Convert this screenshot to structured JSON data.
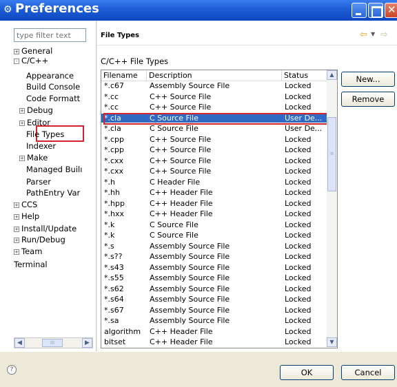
{
  "window": {
    "title": "Preferences",
    "icon": "gear-icon"
  },
  "left": {
    "filter_placeholder": "type filter text",
    "tree": [
      {
        "label": "General",
        "expanded": false
      },
      {
        "label": "C/C++",
        "expanded": true
      },
      {
        "label": "Appearance"
      },
      {
        "label": "Build Console"
      },
      {
        "label": "Code Formatt"
      },
      {
        "label": "Debug",
        "expanded": false
      },
      {
        "label": "Editor",
        "expanded": false
      },
      {
        "label": "File Types",
        "selected": true
      },
      {
        "label": "Indexer"
      },
      {
        "label": "Make",
        "expanded": false
      },
      {
        "label": "Managed Builı"
      },
      {
        "label": "Parser"
      },
      {
        "label": "PathEntry Var"
      },
      {
        "label": "CCS",
        "expanded": false
      },
      {
        "label": "Help",
        "expanded": false
      },
      {
        "label": "Install/Update",
        "expanded": false
      },
      {
        "label": "Run/Debug",
        "expanded": false
      },
      {
        "label": "Team",
        "expanded": false
      },
      {
        "label": "Terminal"
      }
    ],
    "scroll_thumb": "III"
  },
  "right": {
    "page_title": "File Types",
    "section_label": "C/C++ File Types",
    "columns": [
      "Filename",
      "Description",
      "Status"
    ],
    "rows": [
      [
        "*.c67",
        "Assembly Source File",
        "Locked"
      ],
      [
        "*.cc",
        "C++ Source File",
        "Locked"
      ],
      [
        "*.cc",
        "C++ Source File",
        "Locked"
      ],
      [
        "*.cla",
        "C Source File",
        "User De..."
      ],
      [
        "*.cla",
        "C Source File",
        "User De..."
      ],
      [
        "*.cpp",
        "C++ Source File",
        "Locked"
      ],
      [
        "*.cpp",
        "C++ Source File",
        "Locked"
      ],
      [
        "*.cxx",
        "C++ Source File",
        "Locked"
      ],
      [
        "*.cxx",
        "C++ Source File",
        "Locked"
      ],
      [
        "*.h",
        "C Header File",
        "Locked"
      ],
      [
        "*.hh",
        "C++ Header File",
        "Locked"
      ],
      [
        "*.hpp",
        "C++ Header File",
        "Locked"
      ],
      [
        "*.hxx",
        "C++ Header File",
        "Locked"
      ],
      [
        "*.k",
        "C Source File",
        "Locked"
      ],
      [
        "*.k",
        "C Source File",
        "Locked"
      ],
      [
        "*.s",
        "Assembly Source File",
        "Locked"
      ],
      [
        "*.s??",
        "Assembly Source File",
        "Locked"
      ],
      [
        "*.s43",
        "Assembly Source File",
        "Locked"
      ],
      [
        "*.s55",
        "Assembly Source File",
        "Locked"
      ],
      [
        "*.s62",
        "Assembly Source File",
        "Locked"
      ],
      [
        "*.s64",
        "Assembly Source File",
        "Locked"
      ],
      [
        "*.s67",
        "Assembly Source File",
        "Locked"
      ],
      [
        "*.sa",
        "Assembly Source File",
        "Locked"
      ],
      [
        "algorithm",
        "C++ Header File",
        "Locked"
      ],
      [
        "bitset",
        "C++ Header File",
        "Locked"
      ]
    ],
    "selected_row": 3,
    "buttons": {
      "new": "New...",
      "remove": "Remove"
    }
  },
  "footer": {
    "ok": "OK",
    "cancel": "Cancel"
  },
  "colors": {
    "titlebar": "#1e5fd8",
    "selection": "#316ac5",
    "highlight_box": "#d3232f"
  }
}
